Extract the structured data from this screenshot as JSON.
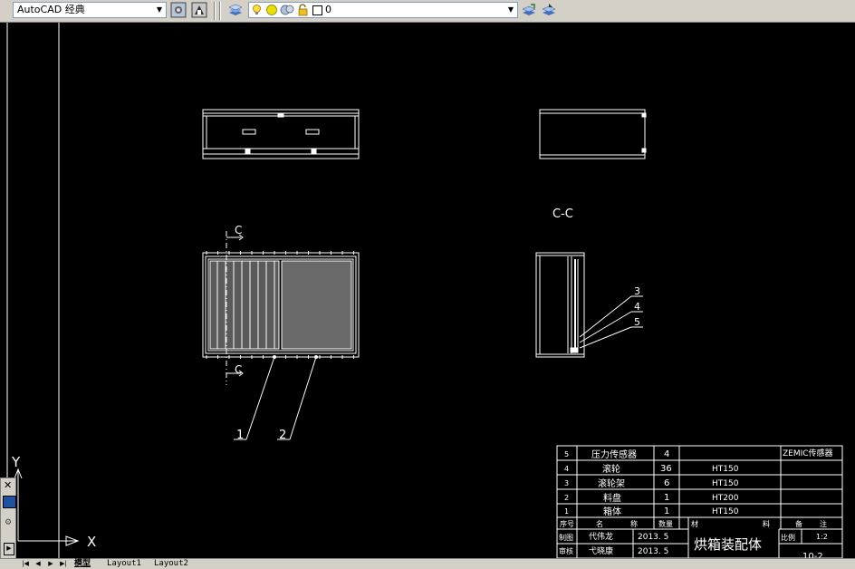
{
  "toolbar": {
    "workspace": "AutoCAD 经典",
    "layer_value": "0",
    "icons": [
      "workspace-settings-icon",
      "workspace-save-icon",
      "layer-manager-icon",
      "light-bulb-icon",
      "sun-icon",
      "freeze-icon",
      "lock-icon",
      "layer-color-swatch-icon",
      "layer-previous-icon",
      "layer-state-icon"
    ]
  },
  "drawing": {
    "section_label": "C-C",
    "cut_mark_top": "C",
    "cut_mark_bottom": "C",
    "balloons": [
      "1",
      "2",
      "3",
      "4",
      "5"
    ],
    "ucs_x": "X",
    "ucs_y": "Y"
  },
  "title_block": {
    "parts": [
      {
        "no": "5",
        "name": "压力传感器",
        "qty": "4",
        "material": "",
        "remark": "ZEMIC传感器"
      },
      {
        "no": "4",
        "name": "滚轮",
        "qty": "36",
        "material": "HT150",
        "remark": ""
      },
      {
        "no": "3",
        "name": "滚轮架",
        "qty": "6",
        "material": "HT150",
        "remark": ""
      },
      {
        "no": "2",
        "name": "料盘",
        "qty": "1",
        "material": "HT200",
        "remark": ""
      },
      {
        "no": "1",
        "name": "箱体",
        "qty": "1",
        "material": "HT150",
        "remark": ""
      }
    ],
    "header": {
      "no": "序号",
      "name_a": "名",
      "name_b": "称",
      "qty": "数量",
      "mat_a": "材",
      "mat_b": "料",
      "rem_a": "备",
      "rem_b": "注"
    },
    "drawn_by_label": "制图",
    "drawn_by": "代伟龙",
    "drawn_date": "2013. 5",
    "checked_by_label": "审核",
    "checked_by": "弋晓康",
    "checked_date": "2013. 5",
    "title": "烘箱装配体",
    "scale_label": "比例",
    "scale": "1:2",
    "drawing_no": "10-2"
  },
  "status": {
    "tabs": [
      "模型",
      "Layout1",
      "Layout2"
    ],
    "nav": [
      "|◀",
      "◀",
      "▶",
      "▶|"
    ]
  },
  "colors": {
    "canvas": "#000000",
    "line": "#ffffff",
    "toolbar": "#d4d0c8"
  }
}
